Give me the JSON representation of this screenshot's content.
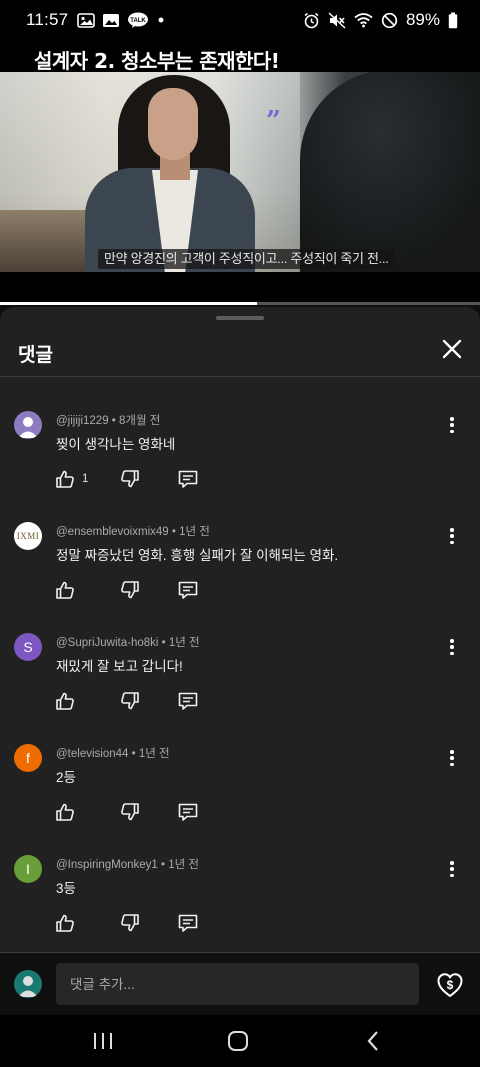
{
  "status_bar": {
    "time": "11:57",
    "left_icons": [
      "gallery-icon",
      "image-icon",
      "talk-chat-icon",
      "dot-icon"
    ],
    "talk_badge": "TALK",
    "right_icons": [
      "alarm-icon",
      "mute-icon",
      "wifi-icon",
      "do-not-disturb-icon",
      "battery-icon"
    ],
    "battery_percent": "89%"
  },
  "video": {
    "title": "설계자 2. 청소부는 존재한다!",
    "subtitle": "만약 앙경진의 고객이 주성직이고... 주성직이 죽기 전...",
    "quote_mark": "”",
    "progress": 0.535
  },
  "comments_panel": {
    "title": "댓글",
    "close_icon": "close-icon",
    "comments": [
      {
        "author": "@jijiji1229",
        "time": "8개월 전",
        "text": "찢이 생각나는 영화네",
        "likes": "1",
        "avatar": {
          "type": "default",
          "color": "#8e7cc3"
        }
      },
      {
        "author": "@ensemblevoixmix49",
        "time": "1년 전",
        "text": "정말 짜증났던 영화. 흥행 실패가 잘 이해되는 영화.",
        "likes": "",
        "avatar": {
          "type": "logo",
          "text": "IXMI",
          "color": "#ffffff"
        }
      },
      {
        "author": "@SupriJuwita-ho8ki",
        "time": "1년 전",
        "text": "재밌게 잘 보고 갑니다!",
        "likes": "",
        "avatar": {
          "type": "letter",
          "text": "S",
          "color": "#7e57c2"
        }
      },
      {
        "author": "@television44",
        "time": "1년 전",
        "text": "2등",
        "likes": "",
        "avatar": {
          "type": "letter",
          "text": "f",
          "color": "#ef6c00"
        }
      },
      {
        "author": "@InspiringMonkey1",
        "time": "1년 전",
        "text": "3등",
        "likes": "",
        "avatar": {
          "type": "letter",
          "text": "I",
          "color": "#689f38"
        }
      }
    ],
    "action_icons": [
      "like-icon",
      "dislike-icon",
      "reply-icon",
      "more-options-icon"
    ]
  },
  "add_comment": {
    "placeholder": "댓글 추가...",
    "thanks_icon": "super-thanks-icon"
  },
  "nav_bar": {
    "icons": [
      "recent-apps-icon",
      "home-icon",
      "back-icon"
    ]
  },
  "colors": {
    "background": "#0f0f0f",
    "sheet": "#212121",
    "meta_text": "#aaaaaa",
    "input_bg": "#272727"
  }
}
